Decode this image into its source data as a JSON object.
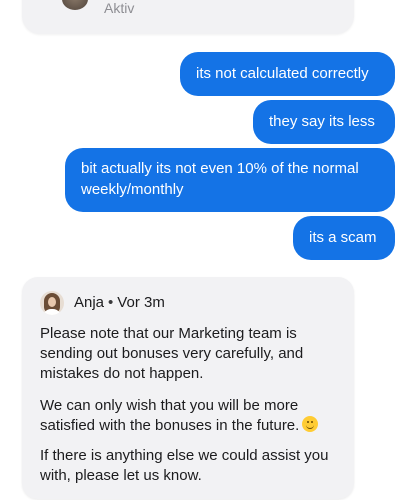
{
  "top_card": {
    "status": "Aktiv"
  },
  "messages_out": [
    "its not calculated correctly",
    "they say its less",
    "bit actually its not even 10% of the normal weekly/monthly",
    "its a scam"
  ],
  "agent": {
    "name": "Anja",
    "separator": "•",
    "time": "Vor 3m",
    "paragraphs": [
      "Please note that our Marketing team is sending out bonuses very carefully, and mistakes do not happen.",
      "We can only wish that you will be more satisfied with the bonuses in the future.",
      "If there is anything else we could assist you with, please let us know."
    ],
    "emoji": "smiling-face-emoji"
  }
}
